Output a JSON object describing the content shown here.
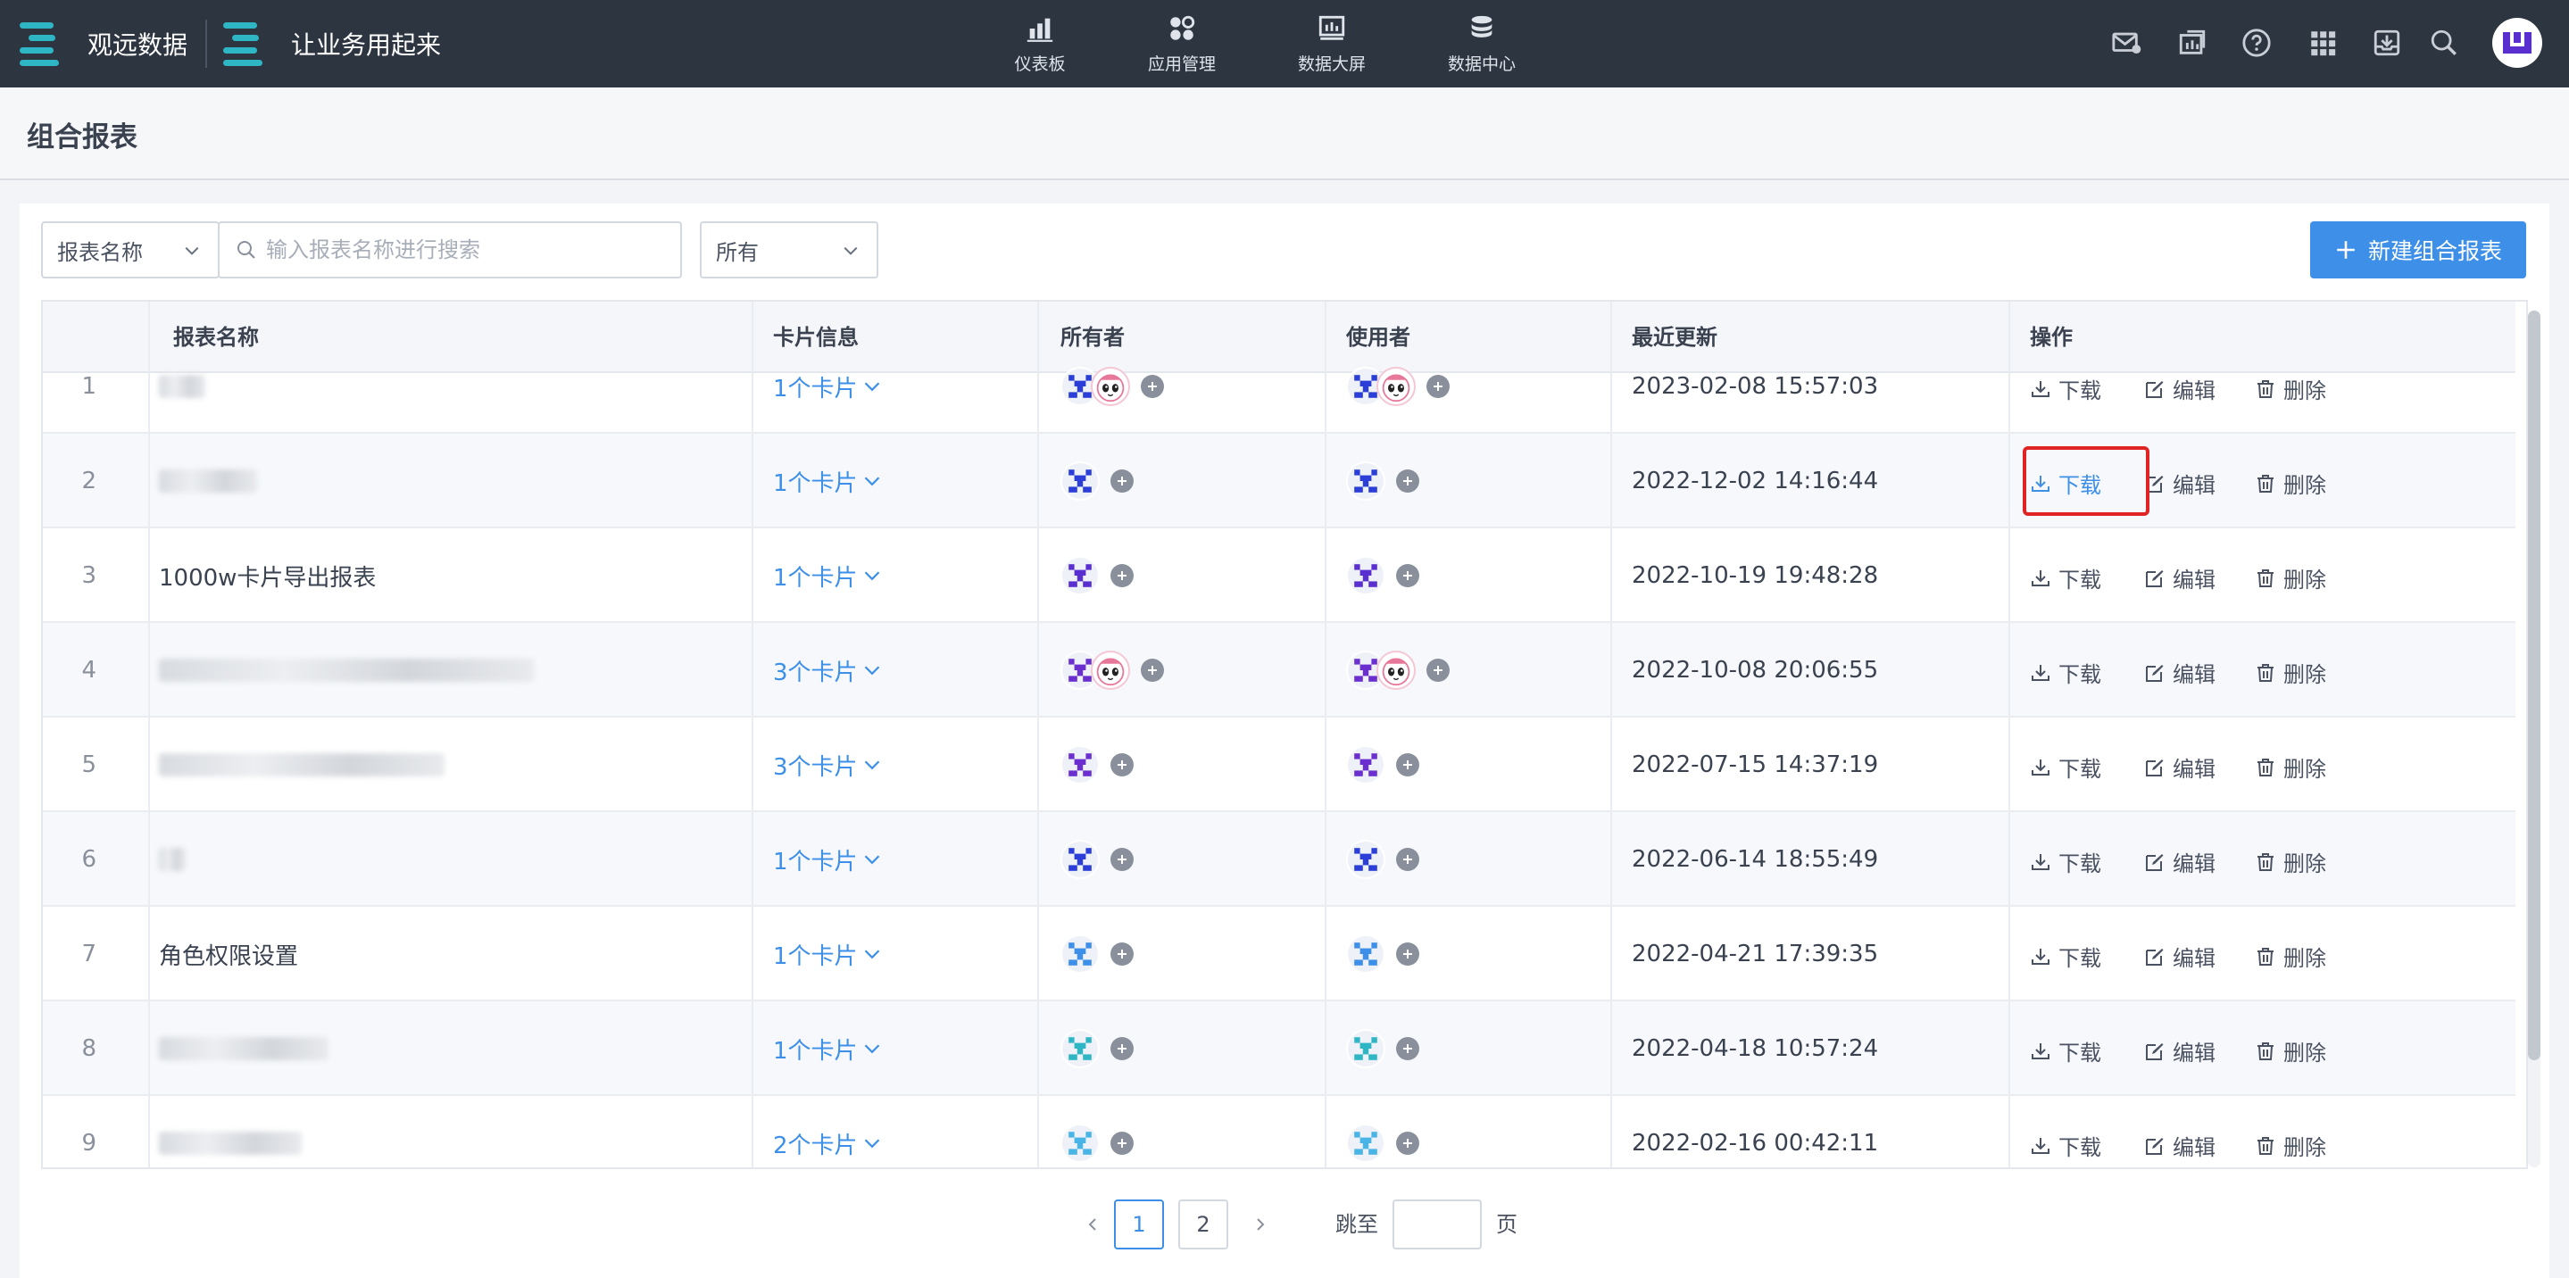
{
  "topbar": {
    "brand1": "观远数据",
    "brand2": "让业务用起来",
    "nav": [
      {
        "label": "仪表板",
        "icon": "bar-chart-icon"
      },
      {
        "label": "应用管理",
        "icon": "apps-grid-icon"
      },
      {
        "label": "数据大屏",
        "icon": "big-screen-icon"
      },
      {
        "label": "数据中心",
        "icon": "database-icon"
      }
    ],
    "right_icons": [
      "mail-icon",
      "dashboard-share-icon",
      "help-icon",
      "apps-icon",
      "download-tray-icon",
      "search-icon"
    ]
  },
  "page": {
    "title": "组合报表"
  },
  "filters": {
    "field_select": "报表名称",
    "search_placeholder": "输入报表名称进行搜索",
    "scope_select": "所有"
  },
  "actions": {
    "new_button": "新建组合报表"
  },
  "table": {
    "columns": [
      "报表名称",
      "卡片信息",
      "所有者",
      "使用者",
      "最近更新",
      "操作"
    ],
    "rows": [
      {
        "index": "1",
        "name": "",
        "cards": "1个卡片",
        "updated": "2023-02-08 15:57:03"
      },
      {
        "index": "2",
        "name": "",
        "cards": "1个卡片",
        "updated": "2022-12-02 14:16:44"
      },
      {
        "index": "3",
        "name": "1000w卡片导出报表",
        "cards": "1个卡片",
        "updated": "2022-10-19 19:48:28"
      },
      {
        "index": "4",
        "name": "",
        "cards": "3个卡片",
        "updated": "2022-10-08 20:06:55"
      },
      {
        "index": "5",
        "name": "",
        "cards": "3个卡片",
        "updated": "2022-07-15 14:37:19"
      },
      {
        "index": "6",
        "name": "",
        "cards": "1个卡片",
        "updated": "2022-06-14 18:55:49"
      },
      {
        "index": "7",
        "name": "角色权限设置",
        "cards": "1个卡片",
        "updated": "2022-04-21 17:39:35"
      },
      {
        "index": "8",
        "name": "",
        "cards": "1个卡片",
        "updated": "2022-04-18 10:57:24"
      },
      {
        "index": "9",
        "name": "",
        "cards": "2个卡片",
        "updated": "2022-02-16 00:42:11"
      }
    ],
    "ops": {
      "download": "下载",
      "edit": "编辑",
      "delete": "删除"
    }
  },
  "pagination": {
    "pages": [
      "1",
      "2"
    ],
    "current": "1",
    "jump_label": "跳至",
    "page_unit": "页"
  },
  "colors": {
    "topbar": "#2d3541",
    "accent": "#3d8fe8",
    "highlight": "#e02424"
  }
}
